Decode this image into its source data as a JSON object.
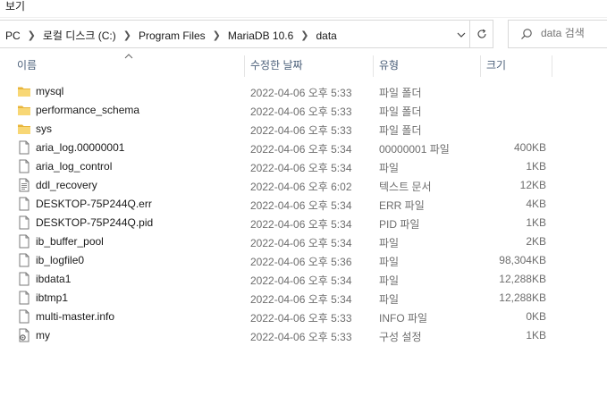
{
  "ribbon": {
    "view_tab": "보기"
  },
  "breadcrumb": {
    "items": [
      "PC",
      "로컬 디스크 (C:)",
      "Program Files",
      "MariaDB 10.6",
      "data"
    ]
  },
  "search": {
    "placeholder": "data 검색"
  },
  "columns": {
    "name": "이름",
    "date": "수정한 날짜",
    "type": "유형",
    "size": "크기"
  },
  "files": [
    {
      "name": "mysql",
      "date": "2022-04-06 오후 5:33",
      "type": "파일 폴더",
      "size": "",
      "icon": "folder-icon"
    },
    {
      "name": "performance_schema",
      "date": "2022-04-06 오후 5:33",
      "type": "파일 폴더",
      "size": "",
      "icon": "folder-icon"
    },
    {
      "name": "sys",
      "date": "2022-04-06 오후 5:33",
      "type": "파일 폴더",
      "size": "",
      "icon": "folder-icon"
    },
    {
      "name": "aria_log.00000001",
      "date": "2022-04-06 오후 5:34",
      "type": "00000001 파일",
      "size": "400KB",
      "icon": "file-icon"
    },
    {
      "name": "aria_log_control",
      "date": "2022-04-06 오후 5:34",
      "type": "파일",
      "size": "1KB",
      "icon": "file-icon"
    },
    {
      "name": "ddl_recovery",
      "date": "2022-04-06 오후 6:02",
      "type": "텍스트 문서",
      "size": "12KB",
      "icon": "text-file-icon"
    },
    {
      "name": "DESKTOP-75P244Q.err",
      "date": "2022-04-06 오후 5:34",
      "type": "ERR 파일",
      "size": "4KB",
      "icon": "file-icon"
    },
    {
      "name": "DESKTOP-75P244Q.pid",
      "date": "2022-04-06 오후 5:34",
      "type": "PID 파일",
      "size": "1KB",
      "icon": "file-icon"
    },
    {
      "name": "ib_buffer_pool",
      "date": "2022-04-06 오후 5:34",
      "type": "파일",
      "size": "2KB",
      "icon": "file-icon"
    },
    {
      "name": "ib_logfile0",
      "date": "2022-04-06 오후 5:36",
      "type": "파일",
      "size": "98,304KB",
      "icon": "file-icon"
    },
    {
      "name": "ibdata1",
      "date": "2022-04-06 오후 5:34",
      "type": "파일",
      "size": "12,288KB",
      "icon": "file-icon"
    },
    {
      "name": "ibtmp1",
      "date": "2022-04-06 오후 5:34",
      "type": "파일",
      "size": "12,288KB",
      "icon": "file-icon"
    },
    {
      "name": "multi-master.info",
      "date": "2022-04-06 오후 5:33",
      "type": "INFO 파일",
      "size": "0KB",
      "icon": "file-icon"
    },
    {
      "name": "my",
      "date": "2022-04-06 오후 5:33",
      "type": "구성 설정",
      "size": "1KB",
      "icon": "config-file-icon"
    }
  ]
}
